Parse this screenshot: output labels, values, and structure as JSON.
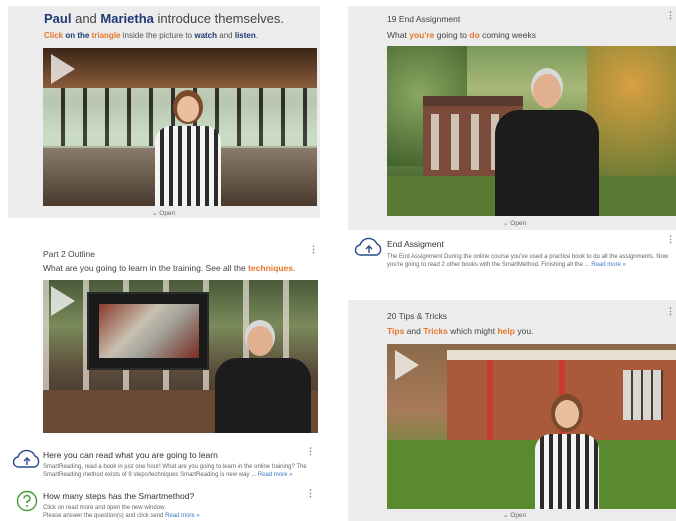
{
  "card1": {
    "title_name1": "Paul",
    "title_and": "and",
    "title_name2": "Marietha",
    "title_rest": "introduce themselves.",
    "instr": {
      "click": "Click",
      "on_the": "on the",
      "triangle": "triangle",
      "inside": "inside the picture to",
      "watch": "watch",
      "and": "and",
      "listen": "listen",
      "period": "."
    },
    "open_label": "Open"
  },
  "card2": {
    "title": "19 End Assignment",
    "sub_a": "What",
    "sub_b": "you're",
    "sub_c": "going to",
    "sub_d": "do",
    "sub_e": "coming weeks",
    "open_label": "Open",
    "info_title": "End Assigment",
    "info_text": "The End Assignment During the online course you've used a practice book to do all the assignments. Now you're going to read 2 other books with the SmartMethod. Finishing all the ...",
    "read_more": "Read more »"
  },
  "card3": {
    "title": "Part 2 Outline",
    "sub_a": "What are you going to learn in the training. See all the",
    "sub_b": "techniques",
    "sub_c": ".",
    "info1_title": "Here you can read what you are going to learn",
    "info1_text": "SmartReading, read a book in just one hour! What are you going to learn in the online training? The SmartReading method exists of 9 steps/techniques SmartReading is new way ...",
    "read_more": "Read more »",
    "info2_title": "How many steps has the Smartmethod?",
    "info2_text_l1": "Click on read more and open the new window.",
    "info2_text_l2": "Please answer the question(s) and click send"
  },
  "card4": {
    "title": "20 Tips & Tricks",
    "sub_a": "Tips",
    "sub_b": "and",
    "sub_c": "Tricks",
    "sub_d": "which might",
    "sub_e": "help",
    "sub_f": "you.",
    "open_label": "Open"
  },
  "ui": {
    "more_glyph": "⋮",
    "chevron": "⌄"
  },
  "colors": {
    "accent_orange": "#e8752a",
    "title_navy": "#1f3b73",
    "link_blue": "#3a7bc8",
    "card_gray": "#ececec"
  }
}
